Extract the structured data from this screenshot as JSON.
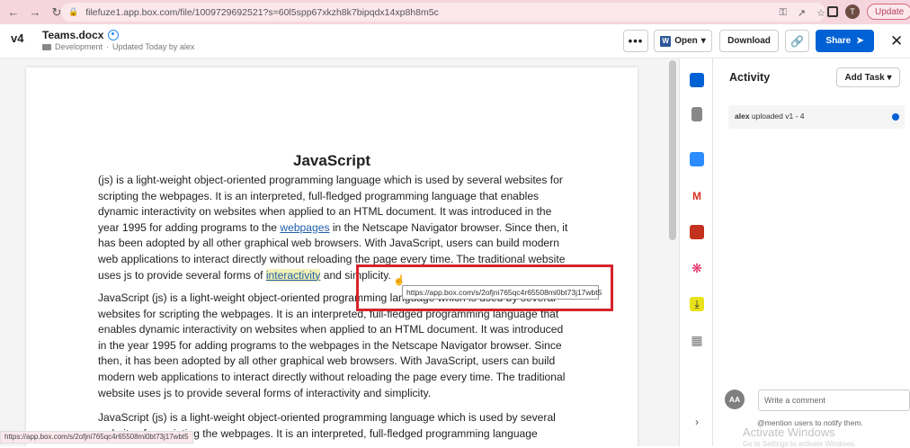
{
  "browser": {
    "url": "filefuze1.app.box.com/file/1009729692521?s=60l5spp67xkzh8k7bipqdx14xp8h8m5c",
    "profile_initial": "T",
    "update_label": "Update"
  },
  "header": {
    "version": "v4",
    "file_name": "Teams.docx",
    "folder": "Development",
    "updated": "Updated Today by alex",
    "more_label": "•••",
    "open_label": "Open",
    "download_label": "Download",
    "share_label": "Share",
    "close_label": "✕"
  },
  "document": {
    "title": "JavaScript",
    "p1_a": " (js) is a light-weight object-oriented programming language which is used by several websites for scripting the webpages. It is an interpreted, full-fledged programming language that enables dynamic interactivity on websites when applied to an HTML document. It was introduced in the year 1995 for adding programs to the ",
    "p1_link": "webpages",
    "p1_b": " in the Netscape Navigator browser. Since then, it has been adopted by all other graphical web browsers. With JavaScript, users can build modern web applications to interact directly without reloading the page every time. The traditional website uses js to provide several forms of ",
    "p1_hl": "interactivity",
    "p1_c": " and simplicity.",
    "p2": "JavaScript (js) is a light-weight object-oriented programming language which is used by several websites for scripting the webpages. It is an interpreted, full-fledged programming language that enables dynamic interactivity on websites when applied to an HTML document. It was introduced in the year 1995 for adding programs to the webpages in the Netscape Navigator browser. Since then, it has been adopted by all other graphical web browsers. With JavaScript, users can build modern web applications to interact directly without reloading the page every time. The traditional website uses js to provide several forms of interactivity and simplicity.",
    "p3": "JavaScript (js) is a light-weight object-oriented programming language which is used by several websites for scripting the webpages. It is an interpreted, full-fledged programming language",
    "tooltip_url": "https://app.box.com/s/2ofjni765qc4r65508mi0bt73j17wbt5",
    "status_url": "https://app.box.com/s/2ofjni765qc4r65508mi0bt73j17wbt5"
  },
  "activity": {
    "title": "Activity",
    "add_task_label": "Add Task",
    "entry_user": "alex",
    "entry_text": " uploaded v1 - 4",
    "commenter_initials": "AA",
    "comment_placeholder": "Write a comment",
    "mention_hint": "@mention users to notify them.",
    "watermark_title": "Activate Windows",
    "watermark_sub": "Go to Settings to activate Windows."
  }
}
